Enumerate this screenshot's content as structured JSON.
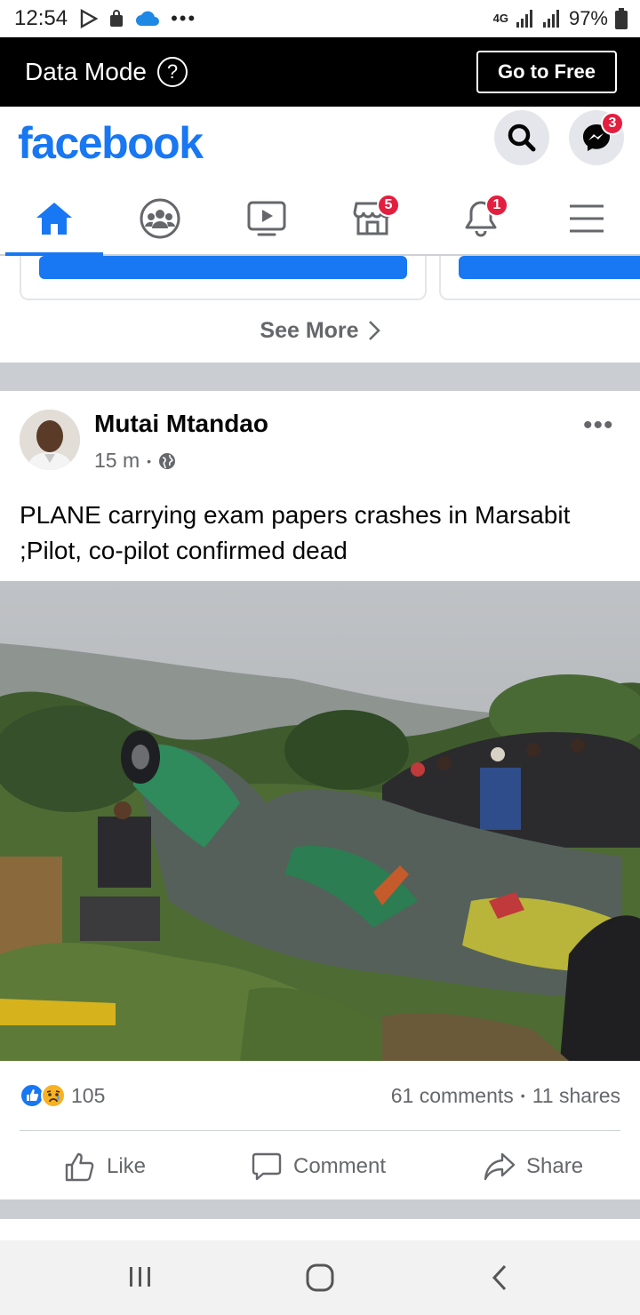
{
  "status_bar": {
    "time": "12:54",
    "network": "4G",
    "battery": "97%",
    "icons": [
      "play-store-icon",
      "bag-icon",
      "cloud-icon",
      "more-icon",
      "signal-icon",
      "battery-icon"
    ]
  },
  "data_mode": {
    "title": "Data Mode",
    "help": "?",
    "go_free": "Go to Free"
  },
  "header": {
    "logo": "facebook",
    "messenger_badge": "3"
  },
  "tabs": {
    "marketplace_badge": "5",
    "notifications_badge": "1",
    "items": [
      "home-icon",
      "groups-icon",
      "watch-icon",
      "marketplace-icon",
      "notifications-icon",
      "menu-icon"
    ]
  },
  "suggestions": {
    "see_more": "See More"
  },
  "post": {
    "author": "Mutai Mtandao",
    "time": "15 m",
    "separator": "•",
    "more": "•••",
    "text": "PLANE carrying exam papers crashes in Marsabit ;Pilot, co-pilot confirmed dead",
    "reaction_count": "105",
    "comments": "61 comments",
    "shares": "11 shares",
    "actions": {
      "like": "Like",
      "comment": "Comment",
      "share": "Share"
    }
  },
  "colors": {
    "brand": "#1877f2",
    "badge": "#e41e3f",
    "secondary_text": "#65676b"
  }
}
